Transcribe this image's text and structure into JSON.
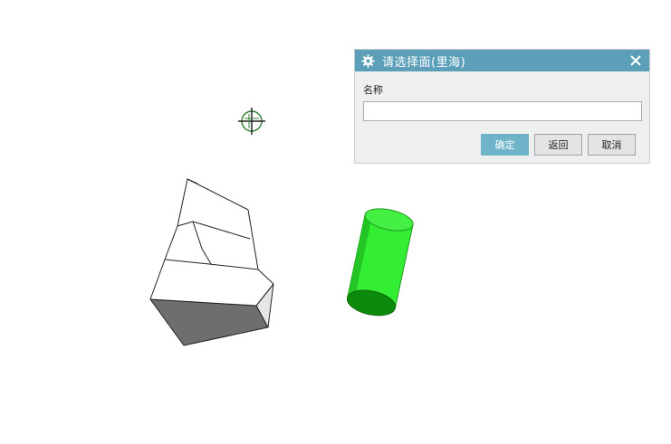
{
  "dialog": {
    "title": "请选择面(里海)",
    "name_label": "名称",
    "name_value": "",
    "confirm_label": "确定",
    "back_label": "返回",
    "cancel_label": "取消",
    "title_icon": "gear-icon",
    "close_icon": "close-icon"
  },
  "colors": {
    "titlebar": "#5b9fb8",
    "dialog_bg": "#eef0f0",
    "confirm_button": "#6fb3c9",
    "cylinder_body": "#33ee33",
    "cylinder_base": "#0b8a0b",
    "solid_dark_face": "#6e6e6e",
    "crosshair": "#2e7d32"
  },
  "viewport": {
    "cursor": "crosshair-icon",
    "objects": [
      "faceted-solid",
      "green-cylinder"
    ]
  }
}
